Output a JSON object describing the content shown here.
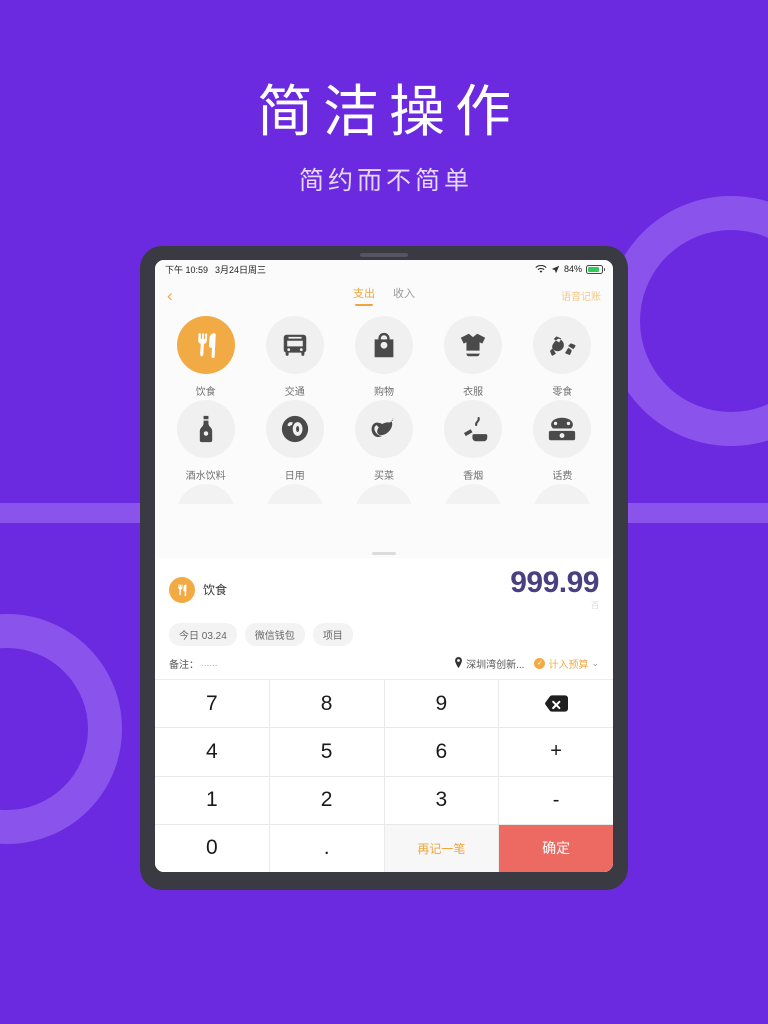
{
  "hero": {
    "title": "简洁操作",
    "subtitle": "简约而不简单"
  },
  "colors": {
    "background": "#6B2AE0",
    "decoration": "#8A54EC",
    "accent_orange": "#F2AB44",
    "confirm_red": "#EC6A62",
    "amount_purple": "#4A3F80",
    "device_frame": "#3A3A42"
  },
  "status_bar": {
    "time": "下午 10:59",
    "date": "3月24日周三",
    "wifi_icon": "wifi-icon",
    "location_icon": "location-arrow-icon",
    "battery_percent": "84%",
    "battery_icon": "battery-charging-icon"
  },
  "navbar": {
    "back_icon": "chevron-left-icon",
    "tabs": [
      {
        "label": "支出",
        "active": true
      },
      {
        "label": "收入",
        "active": false
      }
    ],
    "voice_label": "语音记账"
  },
  "categories": {
    "rows": [
      [
        {
          "label": "饮食",
          "icon": "cutlery-icon",
          "active": true
        },
        {
          "label": "交通",
          "icon": "bus-icon",
          "active": false
        },
        {
          "label": "购物",
          "icon": "shopping-bag-icon",
          "active": false
        },
        {
          "label": "衣服",
          "icon": "tshirt-icon",
          "active": false
        },
        {
          "label": "零食",
          "icon": "candy-icon",
          "active": false
        }
      ],
      [
        {
          "label": "酒水饮料",
          "icon": "bottle-icon",
          "active": false
        },
        {
          "label": "日用",
          "icon": "toilet-paper-icon",
          "active": false
        },
        {
          "label": "买菜",
          "icon": "vegetables-icon",
          "active": false
        },
        {
          "label": "香烟",
          "icon": "cigarette-ashtray-icon",
          "active": false
        },
        {
          "label": "话费",
          "icon": "telephone-icon",
          "active": false
        }
      ]
    ]
  },
  "entry": {
    "category_label": "饮食",
    "category_icon": "cutlery-icon",
    "amount": "999.99",
    "amount_unit": "百",
    "tags": [
      "今日 03.24",
      "微信钱包",
      "项目"
    ],
    "note_label": "备注：",
    "note_value": "......",
    "location_icon": "map-pin-icon",
    "location_text": "深圳湾创新...",
    "budget_label": "计入预算",
    "budget_check_icon": "check-circle-icon",
    "budget_chevron_icon": "chevron-down-icon"
  },
  "keypad": {
    "keys": [
      {
        "label": "7",
        "type": "num",
        "name": "key-7"
      },
      {
        "label": "8",
        "type": "num",
        "name": "key-8"
      },
      {
        "label": "9",
        "type": "num",
        "name": "key-9"
      },
      {
        "label": "",
        "type": "backspace",
        "name": "key-backspace",
        "icon": "backspace-icon"
      },
      {
        "label": "4",
        "type": "num",
        "name": "key-4"
      },
      {
        "label": "5",
        "type": "num",
        "name": "key-5"
      },
      {
        "label": "6",
        "type": "num",
        "name": "key-6"
      },
      {
        "label": "+",
        "type": "op",
        "name": "key-plus"
      },
      {
        "label": "1",
        "type": "num",
        "name": "key-1"
      },
      {
        "label": "2",
        "type": "num",
        "name": "key-2"
      },
      {
        "label": "3",
        "type": "num",
        "name": "key-3"
      },
      {
        "label": "-",
        "type": "op",
        "name": "key-minus"
      },
      {
        "label": "0",
        "type": "zero",
        "name": "key-0"
      },
      {
        "label": ".",
        "type": "num",
        "name": "key-dot"
      },
      {
        "label": "再记一笔",
        "type": "again",
        "name": "key-add-another"
      },
      {
        "label": "确定",
        "type": "confirm",
        "name": "key-confirm"
      }
    ]
  }
}
